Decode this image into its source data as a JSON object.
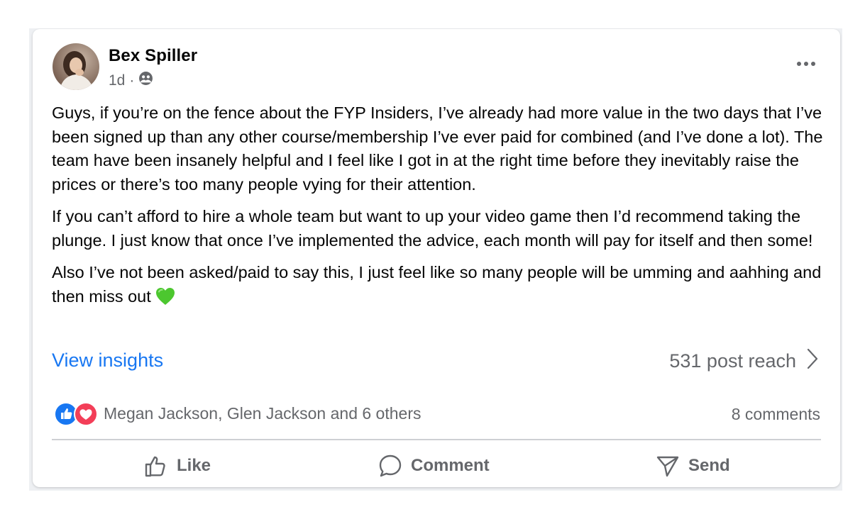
{
  "post": {
    "author": "Bex Spiller",
    "time": "1d",
    "separator": "·",
    "privacy_icon": "friends-icon",
    "paragraphs": [
      "Guys, if you’re on the fence about the FYP Insiders, I’ve already had more value in the two days that I’ve been signed up than any other course/membership I’ve ever paid for combined (and I’ve done a lot). The team have been insanely helpful and I feel like I got in at the right time before they inevitably raise the prices or there’s too many people vying for their attention.",
      "If you can’t afford to hire a whole team but want to up your video game then I’d recommend taking the plunge. I just know that once I’ve implemented the advice, each month will pay for itself and then some!",
      "Also I’ve not been asked/paid to say this, I just feel like so many people will be umming and aahhing and then miss out"
    ],
    "emoji": "💚"
  },
  "insights": {
    "link": "View insights",
    "reach": "531 post reach"
  },
  "engagement": {
    "reactions": [
      "like",
      "love"
    ],
    "reactors": "Megan Jackson, Glen Jackson and 6 others",
    "comments": "8 comments"
  },
  "actions": {
    "like": "Like",
    "comment": "Comment",
    "send": "Send"
  },
  "colors": {
    "link": "#1877f2",
    "secondary_text": "#65676b",
    "like_blue": "#1877f2",
    "love_red": "#f33e58",
    "emoji_green": "#4cc72f"
  }
}
